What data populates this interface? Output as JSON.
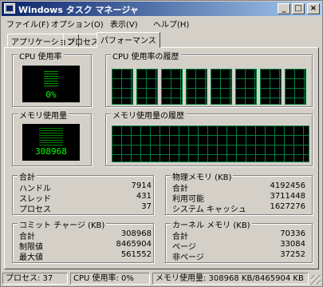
{
  "window": {
    "title": "Windows タスク マネージャ"
  },
  "menu": [
    "ファイル(F)",
    "オプション(O)",
    "表示(V)",
    "ヘルプ(H)"
  ],
  "tabs": [
    {
      "label": "アプリケーション"
    },
    {
      "label": "プロセス"
    },
    {
      "label": "パフォーマンス",
      "active": true
    }
  ],
  "cpu": {
    "title": "CPU 使用率",
    "value": "0%",
    "history_title": "CPU 使用率の履歴",
    "history_panes": 8
  },
  "memory": {
    "title": "メモリ使用量",
    "value": "308968",
    "history_title": "メモリ使用量の履歴"
  },
  "totals": {
    "title": "合計",
    "rows": [
      {
        "label": "ハンドル",
        "value": "7914"
      },
      {
        "label": "スレッド",
        "value": "431"
      },
      {
        "label": "プロセス",
        "value": "37"
      }
    ]
  },
  "physical": {
    "title": "物理メモリ (KB)",
    "rows": [
      {
        "label": "合計",
        "value": "4192456"
      },
      {
        "label": "利用可能",
        "value": "3711448"
      },
      {
        "label": "システム キャッシュ",
        "value": "1627276"
      }
    ]
  },
  "commit": {
    "title": "コミット チャージ (KB)",
    "rows": [
      {
        "label": "合計",
        "value": "308968"
      },
      {
        "label": "制限値",
        "value": "8465904"
      },
      {
        "label": "最大値",
        "value": "561552"
      }
    ]
  },
  "kernel": {
    "title": "カーネル メモリ (KB)",
    "rows": [
      {
        "label": "合計",
        "value": "70336"
      },
      {
        "label": "ページ",
        "value": "33084"
      },
      {
        "label": "非ページ",
        "value": "37252"
      }
    ]
  },
  "status": {
    "processes": "プロセス: 37",
    "cpu": "CPU 使用率: 0%",
    "memory": "メモリ使用量: 308968 KB/8465904 KB"
  },
  "colors": {
    "title_start": "#0a246a",
    "title_end": "#a6caf0",
    "graph_grid": "#008040",
    "graph_text": "#00ff00"
  }
}
